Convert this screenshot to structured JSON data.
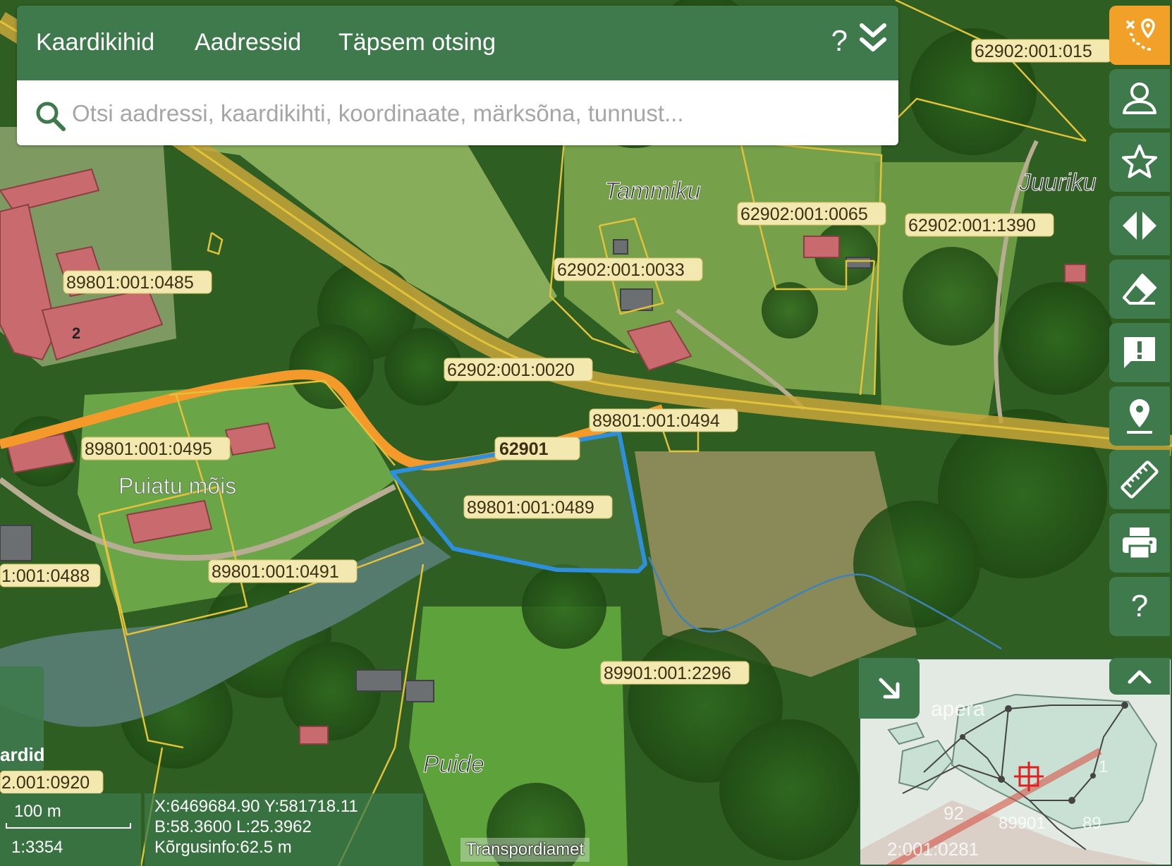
{
  "search_panel": {
    "tabs": [
      "Kaardikihid",
      "Aadressid",
      "Täpsem otsing"
    ],
    "help_label": "?",
    "search_placeholder": "Otsi aadressi, kaardikihti, koordinaate, märksõna, tunnust..."
  },
  "map": {
    "place_names": [
      "Tammiku",
      "Juuriku",
      "Puiatu mõis",
      "Puide"
    ],
    "parcel_labels": [
      "62902:001:015",
      "62902:001:0065",
      "62902:001:1390",
      "62902:001:0033",
      "89801:001:0485",
      "62902:001:0020",
      "89801:001:0494",
      "62901",
      "89801:001:0495",
      "89801:001:0489",
      "89801:001:0491",
      "1:001:0488",
      "89901:001:2296",
      "2.001:0920"
    ],
    "building_number": "2"
  },
  "toolbar": {
    "buttons": [
      {
        "icon": "route-pin-icon",
        "active": true
      },
      {
        "icon": "user-icon"
      },
      {
        "icon": "star-icon"
      },
      {
        "icon": "compare-arrows-icon"
      },
      {
        "icon": "eraser-icon"
      },
      {
        "icon": "feedback-icon"
      },
      {
        "icon": "location-pin-icon"
      },
      {
        "icon": "ruler-icon"
      },
      {
        "icon": "print-icon"
      },
      {
        "icon": "help-icon",
        "label": "?"
      }
    ]
  },
  "left_tab": {
    "label": "ardid"
  },
  "scale": {
    "distance": "100 m",
    "ratio": "1:3354"
  },
  "coordinates": {
    "xy": "X:6469684.90 Y:581718.11",
    "bl": "B:58.3600 L:25.3962",
    "height": "Kõrgusinfo:62.5 m"
  },
  "attribution": "Transpordiamet",
  "minimap": {
    "labels": [
      "apera",
      "92",
      "89901",
      "89",
      "2:001:0281",
      "1"
    ]
  },
  "colors": {
    "panel_green": "#3e7a4c",
    "active_orange": "#f2a128",
    "parcel_yellow": "#e2c23a",
    "selected_parcel_blue": "#2e8fdc",
    "road_orange": "#f39a2b"
  }
}
